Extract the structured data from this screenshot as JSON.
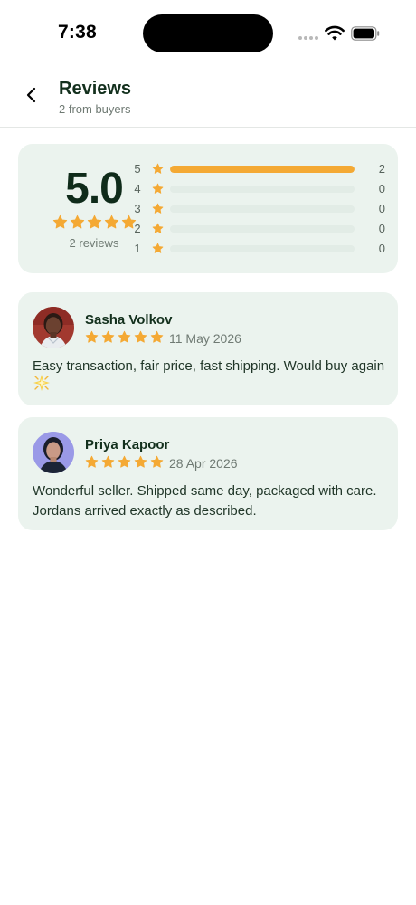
{
  "status_bar": {
    "time": "7:38"
  },
  "header": {
    "title": "Reviews",
    "subtitle": "2 from buyers",
    "back_icon": "chevron-left-icon"
  },
  "summary": {
    "average": "5.0",
    "stars": 5,
    "count_label": "2 reviews",
    "distribution": [
      {
        "stars": "5",
        "count": "2",
        "fraction": 1.0
      },
      {
        "stars": "4",
        "count": "0",
        "fraction": 0.0
      },
      {
        "stars": "3",
        "count": "0",
        "fraction": 0.0
      },
      {
        "stars": "2",
        "count": "0",
        "fraction": 0.0
      },
      {
        "stars": "1",
        "count": "0",
        "fraction": 0.0
      }
    ]
  },
  "reviews": [
    {
      "name": "Sasha Volkov",
      "rating": 5,
      "date": "11 May 2026",
      "text": "Easy transaction, fair price, fast shipping. Would buy again",
      "emoji": "sparkle-emoji"
    },
    {
      "name": "Priya Kapoor",
      "rating": 5,
      "date": "28 Apr 2026",
      "text": "Wonderful seller. Shipped same day, packaged with care. Jordans arrived exactly as described."
    }
  ],
  "colors": {
    "card_bg": "#ebf3ee",
    "star": "#f4a934",
    "bar_track": "#e2ece6",
    "text_dark": "#13301d",
    "text_muted": "#6f7a73"
  }
}
